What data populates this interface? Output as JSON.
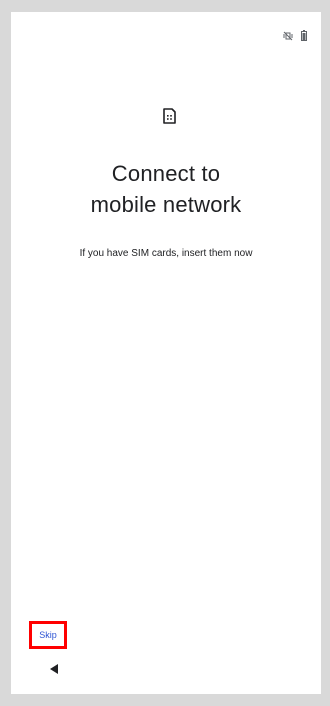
{
  "status_bar": {
    "icons": [
      "vibrate-off-icon",
      "battery-icon"
    ]
  },
  "main": {
    "icon": "sim-card-icon",
    "title_line1": "Connect to",
    "title_line2": "mobile network",
    "subtitle": "If you have SIM cards, insert them now"
  },
  "footer": {
    "skip_label": "Skip"
  },
  "navigation": {
    "back_icon": "back-triangle-icon"
  },
  "colors": {
    "accent": "#2f55d4",
    "highlight": "#ff0000",
    "text": "#202124",
    "frame": "#d9d9d9"
  }
}
